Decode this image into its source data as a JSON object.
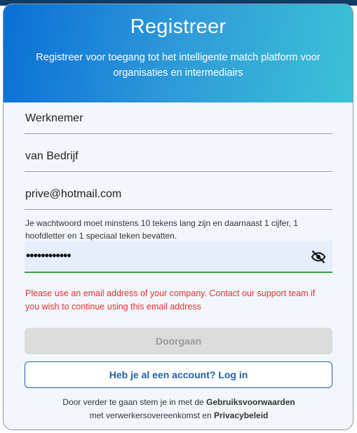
{
  "header": {
    "title": "Registreer",
    "subtitle": "Registreer voor toegang tot het intelligente match platform voor organisaties en intermediairs"
  },
  "form": {
    "first_name": "Werknemer",
    "last_name": "van Bedrijf",
    "email": "prive@hotmail.com",
    "password_hint": "Je wachtwoord moet minstens 10 tekens lang zijn en daarnaast 1 cijfer, 1 hoofdletter en 1 speciaal teken bevatten.",
    "password_masked": "••••••••••••",
    "password_toggle_icon": "eye-off-icon",
    "error": "Please use an email address of your company. Contact our support team if you wish to continue using this email address",
    "continue_label": "Doorgaan",
    "login_label": "Heb je al een account? Log in"
  },
  "footer": {
    "text_1": "Door verder te gaan stem je in met de ",
    "terms_link": "Gebruiksvoorwaarden",
    "text_2": " met verwerkersovereenkomst en ",
    "privacy_link": "Privacybeleid"
  },
  "colors": {
    "header_gradient_start": "#0a6fd6",
    "header_gradient_end": "#3cc2d6",
    "error": "#e0332c",
    "primary": "#1d5fa8",
    "focus_underline": "#3aa14a"
  }
}
